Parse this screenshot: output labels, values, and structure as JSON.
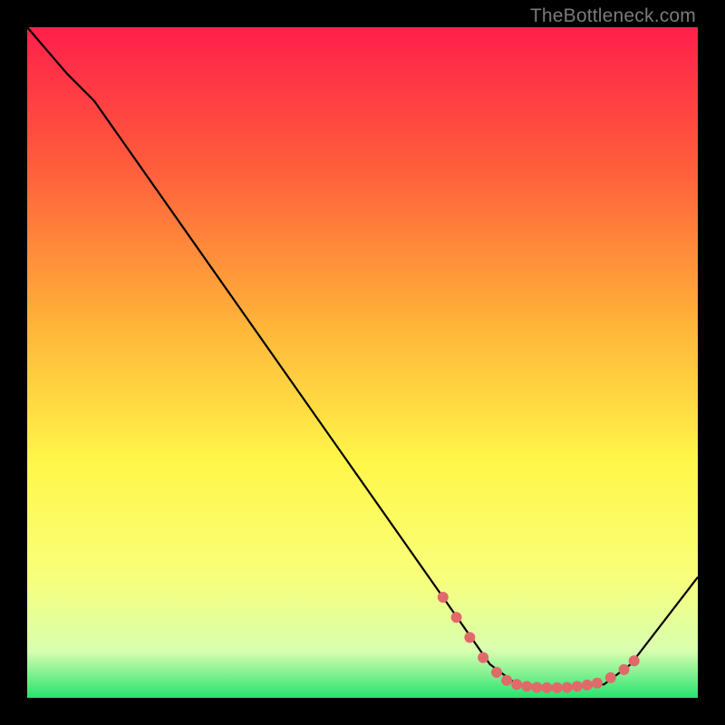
{
  "watermark": "TheBottleneck.com",
  "chart_data": {
    "type": "line",
    "title": "",
    "xlabel": "",
    "ylabel": "",
    "xlim": [
      0,
      100
    ],
    "ylim": [
      0,
      100
    ],
    "background_gradient": {
      "stops": [
        {
          "offset": 0,
          "color": "#ff1f4b"
        },
        {
          "offset": 20,
          "color": "#ff5a3c"
        },
        {
          "offset": 45,
          "color": "#ffb63a"
        },
        {
          "offset": 65,
          "color": "#fff74a"
        },
        {
          "offset": 82,
          "color": "#f8ff7a"
        },
        {
          "offset": 93,
          "color": "#d8ffb0"
        },
        {
          "offset": 100,
          "color": "#26e36f"
        }
      ]
    },
    "series": [
      {
        "name": "bottleneck-curve",
        "color": "#000000",
        "points": [
          {
            "x": 0,
            "y": 100
          },
          {
            "x": 6,
            "y": 93
          },
          {
            "x": 10,
            "y": 89
          },
          {
            "x": 62,
            "y": 15
          },
          {
            "x": 69,
            "y": 5
          },
          {
            "x": 73,
            "y": 2
          },
          {
            "x": 80,
            "y": 1.5
          },
          {
            "x": 86,
            "y": 2
          },
          {
            "x": 90,
            "y": 5
          },
          {
            "x": 100,
            "y": 18
          }
        ]
      }
    ],
    "dotted_overlay": {
      "name": "highlight-dots",
      "color": "#e06a6a",
      "radius": 6,
      "points": [
        {
          "x": 62,
          "y": 15
        },
        {
          "x": 64,
          "y": 12
        },
        {
          "x": 66,
          "y": 9
        },
        {
          "x": 68,
          "y": 6
        },
        {
          "x": 70,
          "y": 3.8
        },
        {
          "x": 71.5,
          "y": 2.6
        },
        {
          "x": 73,
          "y": 2
        },
        {
          "x": 74.5,
          "y": 1.7
        },
        {
          "x": 76,
          "y": 1.55
        },
        {
          "x": 77.5,
          "y": 1.5
        },
        {
          "x": 79,
          "y": 1.5
        },
        {
          "x": 80.5,
          "y": 1.55
        },
        {
          "x": 82,
          "y": 1.7
        },
        {
          "x": 83.5,
          "y": 1.9
        },
        {
          "x": 85,
          "y": 2.2
        },
        {
          "x": 87,
          "y": 3.0
        },
        {
          "x": 89,
          "y": 4.2
        },
        {
          "x": 90.5,
          "y": 5.5
        }
      ]
    }
  }
}
